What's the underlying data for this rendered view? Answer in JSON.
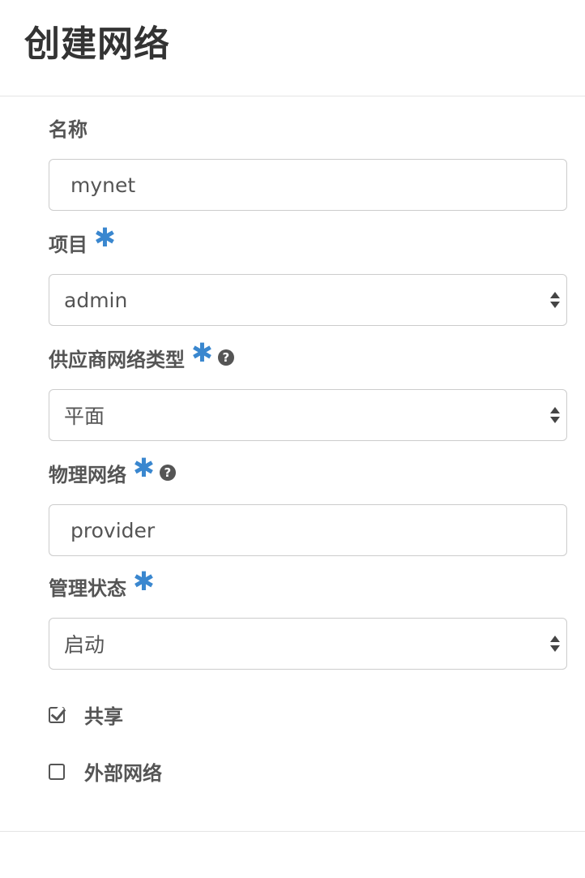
{
  "dialog": {
    "title": "创建网络"
  },
  "fields": {
    "name": {
      "label": "名称",
      "value": "mynet"
    },
    "project": {
      "label": "项目",
      "required_mark": "✱",
      "value": "admin"
    },
    "provider_network_type": {
      "label": "供应商网络类型",
      "required_mark": "✱",
      "help_icon": "question-circle-icon",
      "value": "平面"
    },
    "physical_network": {
      "label": "物理网络",
      "required_mark": "✱",
      "help_icon": "question-circle-icon",
      "value": "provider"
    },
    "admin_state": {
      "label": "管理状态",
      "required_mark": "✱",
      "value": "启动"
    }
  },
  "checkboxes": {
    "shared": {
      "label": "共享",
      "checked": true
    },
    "external": {
      "label": "外部网络",
      "checked": false
    }
  },
  "colors": {
    "required": "#3a87cf",
    "text": "#555555",
    "border": "#cccccc"
  }
}
